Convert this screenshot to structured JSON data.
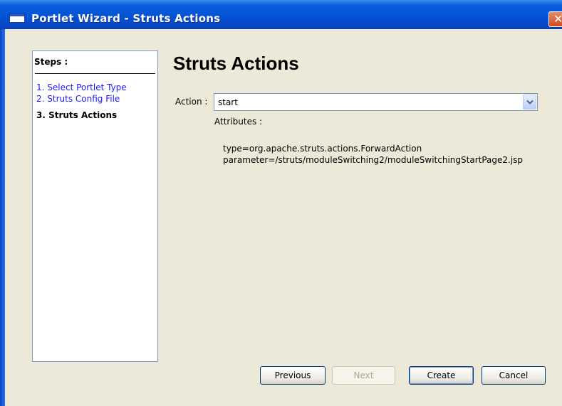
{
  "window": {
    "title": "Portlet Wizard - Struts Actions",
    "close_glyph": "✕"
  },
  "steps": {
    "title": "Steps :",
    "items": [
      {
        "label": "1. Select Portlet Type"
      },
      {
        "label": "2. Struts Config File"
      },
      {
        "label": "3. Struts Actions"
      }
    ],
    "active_index": 2
  },
  "main": {
    "heading": "Struts Actions",
    "action_label": "Action :",
    "action_value": "start",
    "attributes_label": "Attributes :",
    "attributes": [
      "type=org.apache.struts.actions.ForwardAction",
      "parameter=/struts/moduleSwitching2/moduleSwitchingStartPage2.jsp"
    ]
  },
  "buttons": {
    "previous": "Previous",
    "next": "Next",
    "create": "Create",
    "cancel": "Cancel"
  },
  "colors": {
    "titlebar": "#0453d6",
    "step_link": "#1a1aff",
    "dialog_bg": "#ece9d8"
  },
  "icons": {
    "window": "app-window-icon",
    "close": "close-icon",
    "dropdown": "chevron-down-icon"
  }
}
